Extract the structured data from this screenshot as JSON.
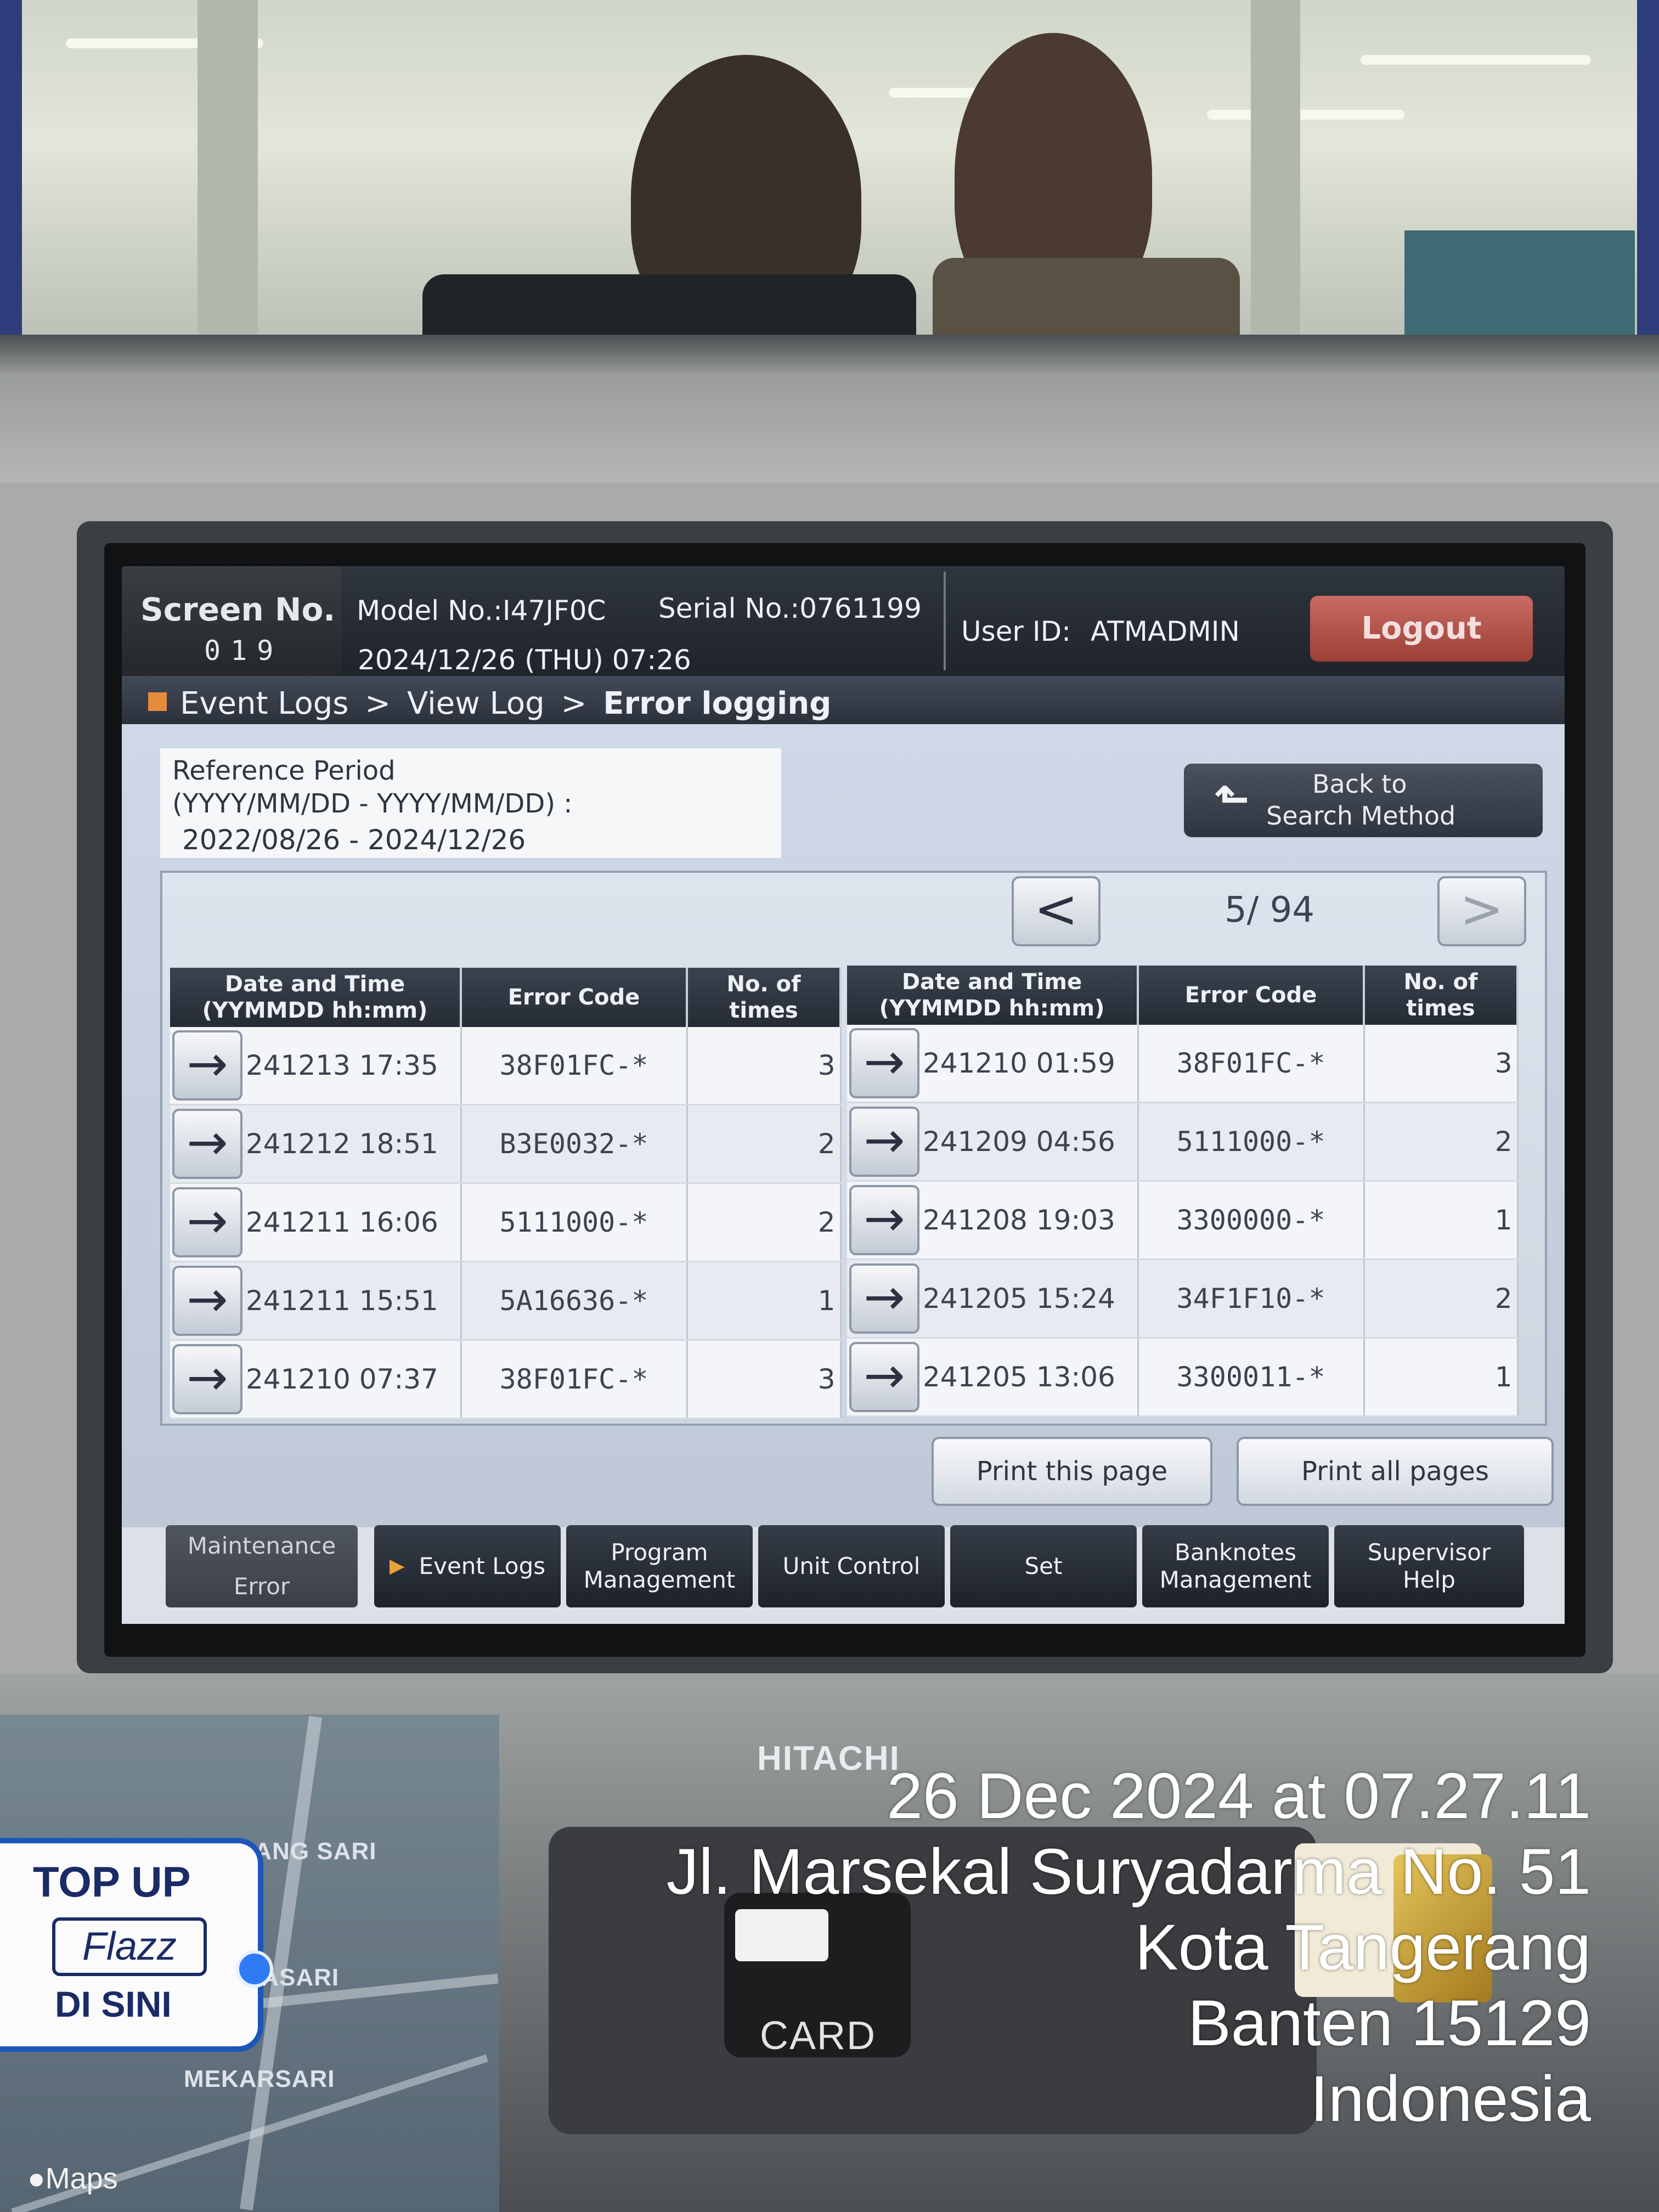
{
  "screen": {
    "screen_no_label": "Screen No.",
    "screen_no": "019",
    "model": "Model No.:I47JF0C",
    "serial": "Serial No.:0761199",
    "datetime": "2024/12/26 (THU) 07:26",
    "user_label": "User ID:",
    "user_id": "ATMADMIN",
    "logout_label": "Logout"
  },
  "breadcrumb": {
    "level1": "Event Logs",
    "sep": ">",
    "level2": "View Log",
    "current": "Error logging"
  },
  "reference": {
    "title": "Reference Period",
    "format": "(YYYY/MM/DD - YYYY/MM/DD) :",
    "value": "2022/08/26 - 2024/12/26"
  },
  "back_button": {
    "line1": "Back to",
    "line2": "Search Method",
    "icon": "return-arrow-icon"
  },
  "pager": {
    "prev": "<",
    "next": ">",
    "current": "5",
    "total": "94",
    "text": "5/ 94"
  },
  "table_headers": {
    "datetime_line1": "Date and Time",
    "datetime_line2": "(YYMMDD hh:mm)",
    "error_code": "Error Code",
    "count_line1": "No. of",
    "count_line2": "times"
  },
  "left_rows": [
    {
      "datetime": "241213 17:35",
      "code": "38F01FC-*",
      "count": "3"
    },
    {
      "datetime": "241212 18:51",
      "code": "B3E0032-*",
      "count": "2"
    },
    {
      "datetime": "241211 16:06",
      "code": "5111000-*",
      "count": "2"
    },
    {
      "datetime": "241211 15:51",
      "code": "5A16636-*",
      "count": "1"
    },
    {
      "datetime": "241210 07:37",
      "code": "38F01FC-*",
      "count": "3"
    }
  ],
  "right_rows": [
    {
      "datetime": "241210 01:59",
      "code": "38F01FC-*",
      "count": "3"
    },
    {
      "datetime": "241209 04:56",
      "code": "5111000-*",
      "count": "2"
    },
    {
      "datetime": "241208 19:03",
      "code": "3300000-*",
      "count": "1"
    },
    {
      "datetime": "241205 15:24",
      "code": "34F1F10-*",
      "count": "2"
    },
    {
      "datetime": "241205 13:06",
      "code": "3300011-*",
      "count": "1"
    }
  ],
  "print": {
    "this_page": "Print this page",
    "all_pages": "Print all pages"
  },
  "tabs": {
    "maintenance_line1": "Maintenance",
    "maintenance_line2": "Error",
    "event_logs": "Event Logs",
    "program_line1": "Program",
    "program_line2": "Management",
    "unit_control": "Unit Control",
    "set": "Set",
    "banknotes_line1": "Banknotes",
    "banknotes_line2": "Management",
    "supervisor_line1": "Supervisor",
    "supervisor_line2": "Help"
  },
  "machine": {
    "brand": "HITACHI",
    "card_label": "CARD"
  },
  "stickers": {
    "topup_line1": "TOP UP",
    "topup_brand": "Flazz",
    "topup_line2": "DI SINI"
  },
  "map": {
    "labels": [
      "KARANG SARI",
      "NEGLASARI",
      "MEKARSARI"
    ],
    "brand": "Maps"
  },
  "caption": {
    "line1": "26 Dec 2024 at 07.27.11",
    "line2": "Jl. Marsekal Suryadarma No. 51",
    "line3": "Kota Tangerang",
    "line4": "Banten 15129",
    "line5": "Indonesia"
  },
  "colors": {
    "header_bg": "#1f242b",
    "logout_red": "#9c3f36",
    "crumb_marker": "#e58b3c",
    "screen_bg": "#c9d0da"
  }
}
